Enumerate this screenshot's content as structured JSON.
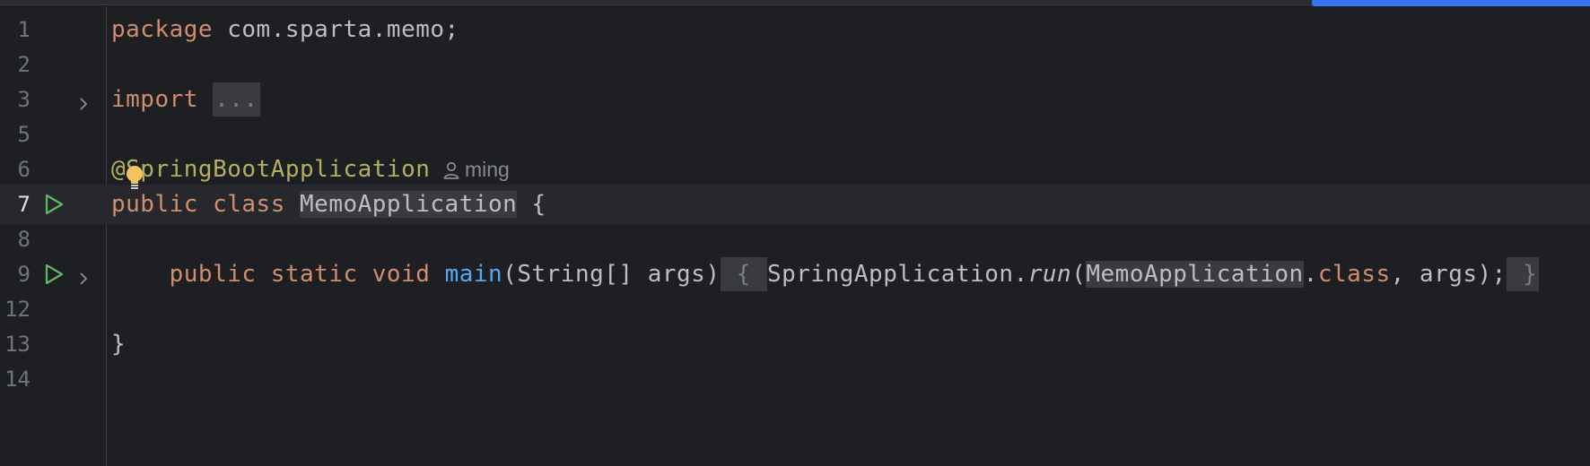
{
  "editor": {
    "lines": [
      {
        "number": "1",
        "tokens": [
          {
            "text": "package",
            "cls": "kw"
          },
          {
            "text": " com.sparta.memo;",
            "cls": "plain"
          }
        ]
      },
      {
        "number": "2",
        "tokens": []
      },
      {
        "number": "3",
        "fold": true,
        "tokens": [
          {
            "text": "import",
            "cls": "kw"
          },
          {
            "text": " ",
            "cls": "plain"
          },
          {
            "text": "...",
            "cls": "fold-box"
          }
        ]
      },
      {
        "number": "5",
        "tokens": []
      },
      {
        "number": "6",
        "tokens": [
          {
            "text": "@SpringBootApplication",
            "cls": "ann"
          }
        ],
        "inlay": "ming"
      },
      {
        "number": "7",
        "current": true,
        "run": true,
        "tokens": [
          {
            "text": "public",
            "cls": "kw"
          },
          {
            "text": " ",
            "cls": "plain"
          },
          {
            "text": "class",
            "cls": "kw"
          },
          {
            "text": " ",
            "cls": "plain"
          },
          {
            "text": "MemoApplication",
            "cls": "plain hl"
          },
          {
            "text": " {",
            "cls": "plain"
          }
        ]
      },
      {
        "number": "8",
        "tokens": []
      },
      {
        "number": "9",
        "run": true,
        "fold": true,
        "tokens": [
          {
            "text": "    ",
            "cls": "plain"
          },
          {
            "text": "public",
            "cls": "kw"
          },
          {
            "text": " ",
            "cls": "plain"
          },
          {
            "text": "static",
            "cls": "kw"
          },
          {
            "text": " ",
            "cls": "plain"
          },
          {
            "text": "void",
            "cls": "kw"
          },
          {
            "text": " ",
            "cls": "plain"
          },
          {
            "text": "main",
            "cls": "fn"
          },
          {
            "text": "(String[] args)",
            "cls": "plain"
          },
          {
            "text": " { ",
            "cls": "fold-box"
          },
          {
            "text": "SpringApplication.",
            "cls": "plain"
          },
          {
            "text": "run",
            "cls": "plain it"
          },
          {
            "text": "(",
            "cls": "plain"
          },
          {
            "text": "MemoApplication",
            "cls": "plain hl"
          },
          {
            "text": ".",
            "cls": "plain"
          },
          {
            "text": "class",
            "cls": "kw"
          },
          {
            "text": ", args);",
            "cls": "plain"
          },
          {
            "text": " }",
            "cls": "fold-box"
          }
        ]
      },
      {
        "number": "12",
        "tokens": []
      },
      {
        "number": "13",
        "tokens": [
          {
            "text": "}",
            "cls": "plain"
          }
        ]
      },
      {
        "number": "14",
        "tokens": []
      }
    ]
  },
  "icons": {
    "run": "run-gutter-icon",
    "fold": "fold-chevron-icon",
    "author": "person-icon",
    "bulb": "lightbulb-icon"
  },
  "colors": {
    "background": "#1e1f22",
    "keyword": "#cf8e6d",
    "annotation": "#b3ae60",
    "function": "#56a8f5",
    "text": "#bcbec4",
    "run_icon": "#5fb865",
    "progress": "#3574f0"
  }
}
